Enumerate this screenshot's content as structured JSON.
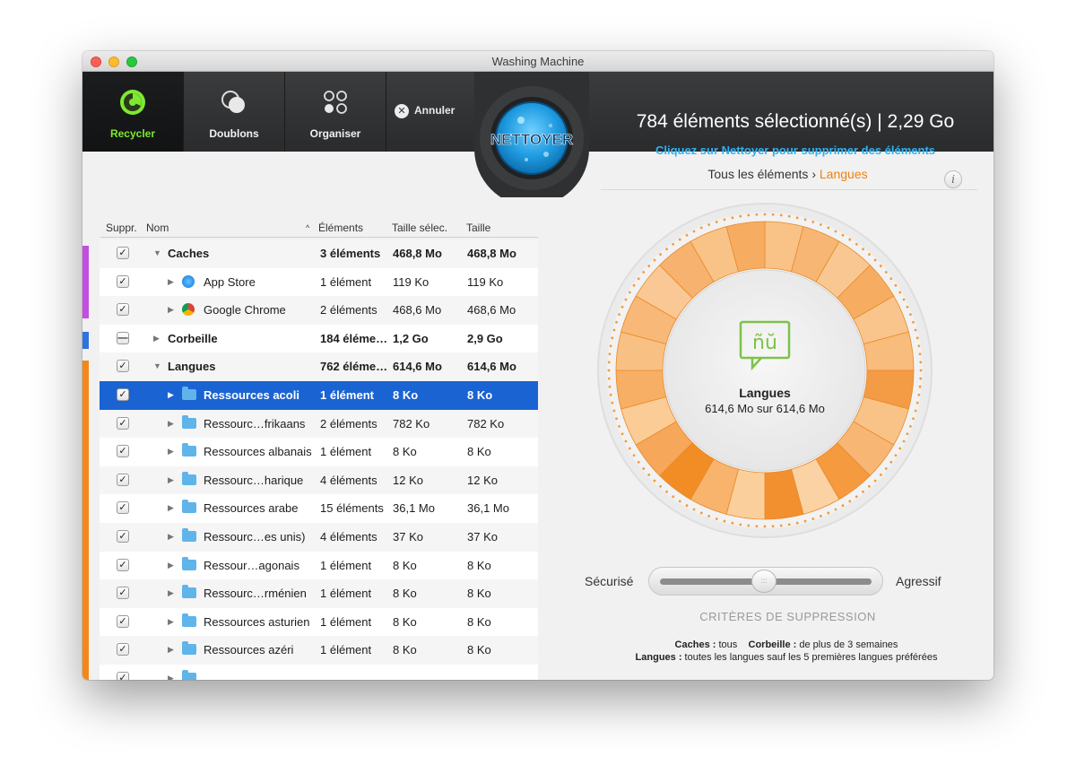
{
  "window": {
    "title": "Washing Machine"
  },
  "toolbar": {
    "buttons": [
      {
        "label": "Recycler",
        "icon": "recycle-gauge-icon",
        "active": true
      },
      {
        "label": "Doublons",
        "icon": "duplicates-icon",
        "active": false
      },
      {
        "label": "Organiser",
        "icon": "organize-grid-icon",
        "active": false
      }
    ],
    "cancel_label": "Annuler",
    "clean_button_label": "NETTOYER",
    "summary": "784 éléments sélectionné(s) | 2,29 Go",
    "hint": "Cliquez sur Nettoyer pour supprimer des éléments"
  },
  "list": {
    "headers": {
      "delete": "Suppr.",
      "name": "Nom",
      "sort_indicator": "^",
      "items": "Éléments",
      "selected_size": "Taille sélec.",
      "size": "Taille"
    },
    "rows": [
      {
        "name": "Caches",
        "items": "3 éléments",
        "selected_size": "468,8 Mo",
        "size": "468,8 Mo",
        "level": 0,
        "expanded": true,
        "check": "checked",
        "bold": true,
        "icon": ""
      },
      {
        "name": "App Store",
        "items": "1 élément",
        "selected_size": "119 Ko",
        "size": "119 Ko",
        "level": 1,
        "expanded": false,
        "check": "checked",
        "bold": false,
        "icon": "app-store-icon"
      },
      {
        "name": "Google Chrome",
        "items": "2 éléments",
        "selected_size": "468,6 Mo",
        "size": "468,6 Mo",
        "level": 1,
        "expanded": false,
        "check": "checked",
        "bold": false,
        "icon": "chrome-icon"
      },
      {
        "name": "Corbeille",
        "items": "184 éléme…",
        "selected_size": "1,2 Go",
        "size": "2,9 Go",
        "level": 0,
        "expanded": false,
        "check": "mixed",
        "bold": true,
        "icon": ""
      },
      {
        "name": "Langues",
        "items": "762 éléme…",
        "selected_size": "614,6 Mo",
        "size": "614,6 Mo",
        "level": 0,
        "expanded": true,
        "check": "checked",
        "bold": true,
        "icon": ""
      },
      {
        "name": "Ressources acoli",
        "items": "1 élément",
        "selected_size": "8 Ko",
        "size": "8 Ko",
        "level": 1,
        "expanded": false,
        "check": "checked",
        "bold": false,
        "icon": "folder-icon",
        "selected": true
      },
      {
        "name": "Ressourc…frikaans",
        "items": "2 éléments",
        "selected_size": "782 Ko",
        "size": "782 Ko",
        "level": 1,
        "expanded": false,
        "check": "checked",
        "bold": false,
        "icon": "folder-icon"
      },
      {
        "name": "Ressources albanais",
        "items": "1 élément",
        "selected_size": "8 Ko",
        "size": "8 Ko",
        "level": 1,
        "expanded": false,
        "check": "checked",
        "bold": false,
        "icon": "folder-icon"
      },
      {
        "name": "Ressourc…harique",
        "items": "4 éléments",
        "selected_size": "12 Ko",
        "size": "12 Ko",
        "level": 1,
        "expanded": false,
        "check": "checked",
        "bold": false,
        "icon": "folder-icon"
      },
      {
        "name": "Ressources arabe",
        "items": "15 éléments",
        "selected_size": "36,1 Mo",
        "size": "36,1 Mo",
        "level": 1,
        "expanded": false,
        "check": "checked",
        "bold": false,
        "icon": "folder-icon"
      },
      {
        "name": "Ressourc…es unis)",
        "items": "4 éléments",
        "selected_size": "37 Ko",
        "size": "37 Ko",
        "level": 1,
        "expanded": false,
        "check": "checked",
        "bold": false,
        "icon": "folder-icon"
      },
      {
        "name": "Ressour…agonais",
        "items": "1 élément",
        "selected_size": "8 Ko",
        "size": "8 Ko",
        "level": 1,
        "expanded": false,
        "check": "checked",
        "bold": false,
        "icon": "folder-icon"
      },
      {
        "name": "Ressourc…rménien",
        "items": "1 élément",
        "selected_size": "8 Ko",
        "size": "8 Ko",
        "level": 1,
        "expanded": false,
        "check": "checked",
        "bold": false,
        "icon": "folder-icon"
      },
      {
        "name": "Ressources asturien",
        "items": "1 élément",
        "selected_size": "8 Ko",
        "size": "8 Ko",
        "level": 1,
        "expanded": false,
        "check": "checked",
        "bold": false,
        "icon": "folder-icon"
      },
      {
        "name": "Ressources azéri",
        "items": "1 élément",
        "selected_size": "8 Ko",
        "size": "8 Ko",
        "level": 1,
        "expanded": false,
        "check": "checked",
        "bold": false,
        "icon": "folder-icon"
      },
      {
        "name": "",
        "items": "",
        "selected_size": "",
        "size": "",
        "level": 1,
        "expanded": false,
        "check": "checked",
        "bold": false,
        "icon": "folder-icon"
      }
    ],
    "category_colors": {
      "caches": "#c24fe0",
      "corbeille": "#2f73de",
      "langues": "#f5861b"
    }
  },
  "detail": {
    "breadcrumb_root": "Tous les éléments",
    "breadcrumb_sep": "›",
    "breadcrumb_current": "Langues",
    "info_label": "i",
    "center_icon": "language-speech-bubble-icon",
    "center_icon_text": "ñŭ",
    "center_title": "Langues",
    "center_subtitle": "614,6 Mo sur 614,6 Mo",
    "accent_color": "#f08a17",
    "icon_color": "#7dc24a"
  },
  "slider": {
    "left_label": "Sécurisé",
    "right_label": "Agressif",
    "level": 0.44
  },
  "criteria": {
    "title": "CRITÈRES DE SUPPRESSION",
    "line1": [
      {
        "key": "Caches :",
        "value": " tous"
      },
      {
        "key": "Corbeille :",
        "value": " de plus de 3 semaines"
      }
    ],
    "line2": [
      {
        "key": "Langues :",
        "value": " toutes les langues sauf les 5 premières langues préférées"
      }
    ]
  }
}
